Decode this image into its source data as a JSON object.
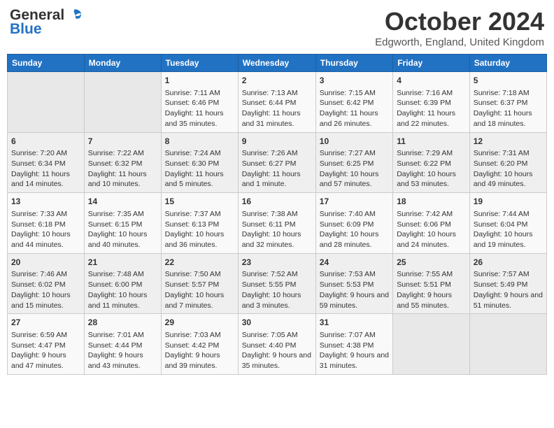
{
  "logo": {
    "line1": "General",
    "line2": "Blue"
  },
  "title": "October 2024",
  "location": "Edgworth, England, United Kingdom",
  "days_of_week": [
    "Sunday",
    "Monday",
    "Tuesday",
    "Wednesday",
    "Thursday",
    "Friday",
    "Saturday"
  ],
  "weeks": [
    [
      {
        "day": "",
        "sunrise": "",
        "sunset": "",
        "daylight": ""
      },
      {
        "day": "",
        "sunrise": "",
        "sunset": "",
        "daylight": ""
      },
      {
        "day": "1",
        "sunrise": "Sunrise: 7:11 AM",
        "sunset": "Sunset: 6:46 PM",
        "daylight": "Daylight: 11 hours and 35 minutes."
      },
      {
        "day": "2",
        "sunrise": "Sunrise: 7:13 AM",
        "sunset": "Sunset: 6:44 PM",
        "daylight": "Daylight: 11 hours and 31 minutes."
      },
      {
        "day": "3",
        "sunrise": "Sunrise: 7:15 AM",
        "sunset": "Sunset: 6:42 PM",
        "daylight": "Daylight: 11 hours and 26 minutes."
      },
      {
        "day": "4",
        "sunrise": "Sunrise: 7:16 AM",
        "sunset": "Sunset: 6:39 PM",
        "daylight": "Daylight: 11 hours and 22 minutes."
      },
      {
        "day": "5",
        "sunrise": "Sunrise: 7:18 AM",
        "sunset": "Sunset: 6:37 PM",
        "daylight": "Daylight: 11 hours and 18 minutes."
      }
    ],
    [
      {
        "day": "6",
        "sunrise": "Sunrise: 7:20 AM",
        "sunset": "Sunset: 6:34 PM",
        "daylight": "Daylight: 11 hours and 14 minutes."
      },
      {
        "day": "7",
        "sunrise": "Sunrise: 7:22 AM",
        "sunset": "Sunset: 6:32 PM",
        "daylight": "Daylight: 11 hours and 10 minutes."
      },
      {
        "day": "8",
        "sunrise": "Sunrise: 7:24 AM",
        "sunset": "Sunset: 6:30 PM",
        "daylight": "Daylight: 11 hours and 5 minutes."
      },
      {
        "day": "9",
        "sunrise": "Sunrise: 7:26 AM",
        "sunset": "Sunset: 6:27 PM",
        "daylight": "Daylight: 11 hours and 1 minute."
      },
      {
        "day": "10",
        "sunrise": "Sunrise: 7:27 AM",
        "sunset": "Sunset: 6:25 PM",
        "daylight": "Daylight: 10 hours and 57 minutes."
      },
      {
        "day": "11",
        "sunrise": "Sunrise: 7:29 AM",
        "sunset": "Sunset: 6:22 PM",
        "daylight": "Daylight: 10 hours and 53 minutes."
      },
      {
        "day": "12",
        "sunrise": "Sunrise: 7:31 AM",
        "sunset": "Sunset: 6:20 PM",
        "daylight": "Daylight: 10 hours and 49 minutes."
      }
    ],
    [
      {
        "day": "13",
        "sunrise": "Sunrise: 7:33 AM",
        "sunset": "Sunset: 6:18 PM",
        "daylight": "Daylight: 10 hours and 44 minutes."
      },
      {
        "day": "14",
        "sunrise": "Sunrise: 7:35 AM",
        "sunset": "Sunset: 6:15 PM",
        "daylight": "Daylight: 10 hours and 40 minutes."
      },
      {
        "day": "15",
        "sunrise": "Sunrise: 7:37 AM",
        "sunset": "Sunset: 6:13 PM",
        "daylight": "Daylight: 10 hours and 36 minutes."
      },
      {
        "day": "16",
        "sunrise": "Sunrise: 7:38 AM",
        "sunset": "Sunset: 6:11 PM",
        "daylight": "Daylight: 10 hours and 32 minutes."
      },
      {
        "day": "17",
        "sunrise": "Sunrise: 7:40 AM",
        "sunset": "Sunset: 6:09 PM",
        "daylight": "Daylight: 10 hours and 28 minutes."
      },
      {
        "day": "18",
        "sunrise": "Sunrise: 7:42 AM",
        "sunset": "Sunset: 6:06 PM",
        "daylight": "Daylight: 10 hours and 24 minutes."
      },
      {
        "day": "19",
        "sunrise": "Sunrise: 7:44 AM",
        "sunset": "Sunset: 6:04 PM",
        "daylight": "Daylight: 10 hours and 19 minutes."
      }
    ],
    [
      {
        "day": "20",
        "sunrise": "Sunrise: 7:46 AM",
        "sunset": "Sunset: 6:02 PM",
        "daylight": "Daylight: 10 hours and 15 minutes."
      },
      {
        "day": "21",
        "sunrise": "Sunrise: 7:48 AM",
        "sunset": "Sunset: 6:00 PM",
        "daylight": "Daylight: 10 hours and 11 minutes."
      },
      {
        "day": "22",
        "sunrise": "Sunrise: 7:50 AM",
        "sunset": "Sunset: 5:57 PM",
        "daylight": "Daylight: 10 hours and 7 minutes."
      },
      {
        "day": "23",
        "sunrise": "Sunrise: 7:52 AM",
        "sunset": "Sunset: 5:55 PM",
        "daylight": "Daylight: 10 hours and 3 minutes."
      },
      {
        "day": "24",
        "sunrise": "Sunrise: 7:53 AM",
        "sunset": "Sunset: 5:53 PM",
        "daylight": "Daylight: 9 hours and 59 minutes."
      },
      {
        "day": "25",
        "sunrise": "Sunrise: 7:55 AM",
        "sunset": "Sunset: 5:51 PM",
        "daylight": "Daylight: 9 hours and 55 minutes."
      },
      {
        "day": "26",
        "sunrise": "Sunrise: 7:57 AM",
        "sunset": "Sunset: 5:49 PM",
        "daylight": "Daylight: 9 hours and 51 minutes."
      }
    ],
    [
      {
        "day": "27",
        "sunrise": "Sunrise: 6:59 AM",
        "sunset": "Sunset: 4:47 PM",
        "daylight": "Daylight: 9 hours and 47 minutes."
      },
      {
        "day": "28",
        "sunrise": "Sunrise: 7:01 AM",
        "sunset": "Sunset: 4:44 PM",
        "daylight": "Daylight: 9 hours and 43 minutes."
      },
      {
        "day": "29",
        "sunrise": "Sunrise: 7:03 AM",
        "sunset": "Sunset: 4:42 PM",
        "daylight": "Daylight: 9 hours and 39 minutes."
      },
      {
        "day": "30",
        "sunrise": "Sunrise: 7:05 AM",
        "sunset": "Sunset: 4:40 PM",
        "daylight": "Daylight: 9 hours and 35 minutes."
      },
      {
        "day": "31",
        "sunrise": "Sunrise: 7:07 AM",
        "sunset": "Sunset: 4:38 PM",
        "daylight": "Daylight: 9 hours and 31 minutes."
      },
      {
        "day": "",
        "sunrise": "",
        "sunset": "",
        "daylight": ""
      },
      {
        "day": "",
        "sunrise": "",
        "sunset": "",
        "daylight": ""
      }
    ]
  ]
}
